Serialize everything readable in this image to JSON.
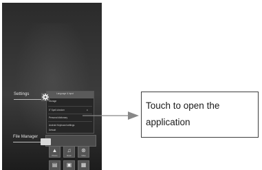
{
  "phone": {
    "settings_label": "Settings",
    "file_manager_label": "File Manager",
    "settings_preview_rows": [
      "Language & input",
      "Storage",
      "IT Spell checker",
      "Personal dictionary",
      "Android Keyboard settings",
      "Default"
    ],
    "app_grid": [
      {
        "icon": "gallery-icon",
        "glyph": "▲",
        "caption": "Photos"
      },
      {
        "icon": "music-icon",
        "glyph": "♫",
        "caption": "Music"
      },
      {
        "icon": "video-icon",
        "glyph": "⊛",
        "caption": "Video"
      },
      {
        "icon": "document-icon",
        "glyph": "▤",
        "caption": ""
      },
      {
        "icon": "apk-icon",
        "glyph": "▣",
        "caption": ""
      },
      {
        "icon": "grid-icon",
        "glyph": "▦",
        "caption": ""
      }
    ]
  },
  "callout": {
    "text": "Touch to open the\napplication"
  },
  "colors": {
    "screen_background": "#333333",
    "callout_border": "#3c3c3c",
    "arrow": "#888888"
  }
}
